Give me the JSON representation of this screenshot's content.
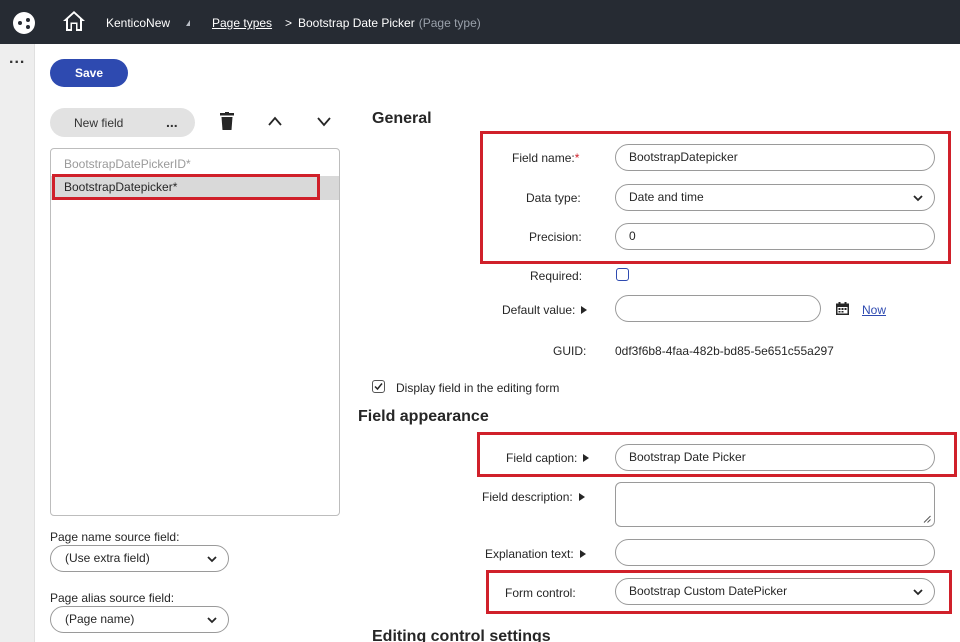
{
  "header": {
    "site_name": "KenticoNew",
    "breadcrumb_link": "Page types",
    "breadcrumb_separator": ">",
    "breadcrumb_current": "Bootstrap Date Picker",
    "breadcrumb_current_suffix": "(Page type)"
  },
  "rail": {
    "more_label": "..."
  },
  "toolbar": {
    "save_label": "Save"
  },
  "field_editor": {
    "new_field_label": "New field",
    "more_label": "...",
    "fields": [
      "BootstrapDatePickerID*",
      "BootstrapDatepicker*"
    ],
    "page_name_source_label": "Page name source field:",
    "page_name_source_value": "(Use extra field)",
    "page_alias_source_label": "Page alias source field:",
    "page_alias_source_value": "(Page name)"
  },
  "general": {
    "title": "General",
    "field_name_label": "Field name:",
    "field_name_required": "*",
    "field_name_value": "BootstrapDatepicker",
    "data_type_label": "Data type:",
    "data_type_value": "Date and time",
    "precision_label": "Precision:",
    "precision_value": "0",
    "required_label": "Required:",
    "required_checked": false,
    "default_value_label": "Default value:",
    "default_value_value": "",
    "now_label": "Now",
    "guid_label": "GUID:",
    "guid_value": "0df3f6b8-4faa-482b-bd85-5e651c55a297",
    "display_field_label": "Display field in the editing form",
    "display_field_checked": true
  },
  "appearance": {
    "title": "Field appearance",
    "caption_label": "Field caption:",
    "caption_value": "Bootstrap Date Picker",
    "description_label": "Field description:",
    "description_value": "",
    "explanation_label": "Explanation text:",
    "explanation_value": "",
    "form_control_label": "Form control:",
    "form_control_value": "Bootstrap Custom DatePicker"
  },
  "editing_control": {
    "title": "Editing control settings"
  },
  "colors": {
    "topbar": "#262b33",
    "primary": "#2e4ab0",
    "highlight": "#d0202a"
  }
}
